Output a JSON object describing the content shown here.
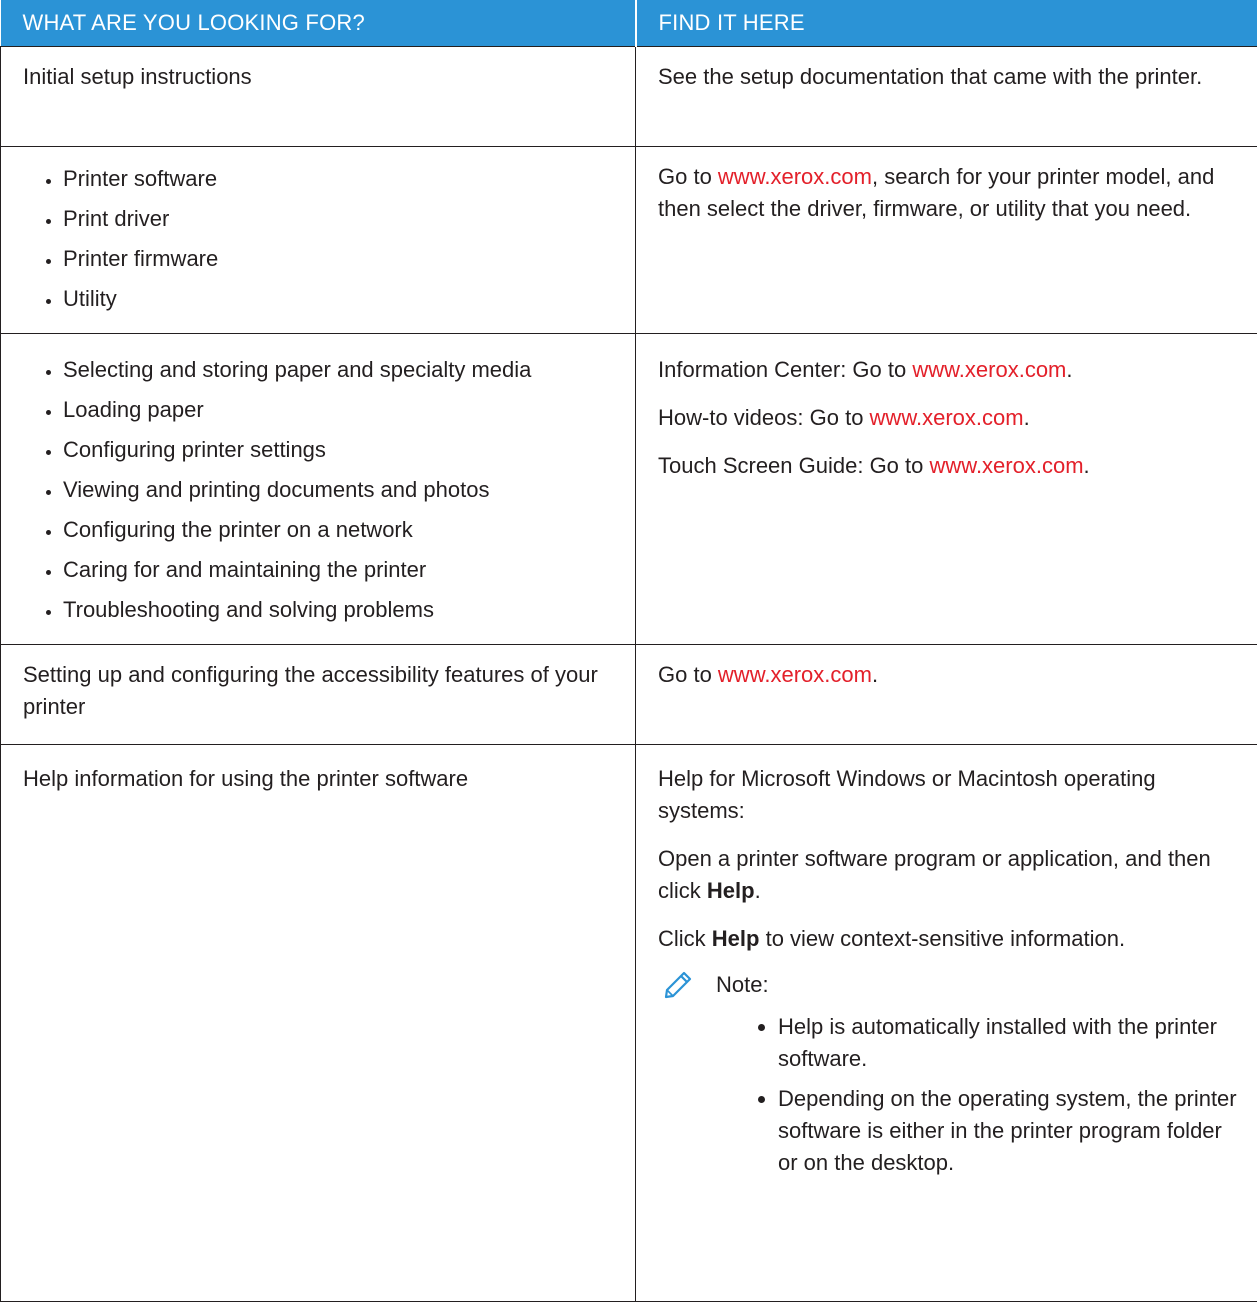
{
  "header": {
    "col1": "WHAT ARE YOU LOOKING FOR?",
    "col2": "FIND IT HERE"
  },
  "rows": [
    {
      "left_text": "Initial setup instructions",
      "right_text": "See the setup documentation that came with the printer."
    },
    {
      "left_items": [
        "Printer software",
        "Print driver",
        "Printer firmware",
        "Utility"
      ],
      "right": {
        "prefix": "Go to ",
        "link": "www.xerox.com",
        "suffix": ", search for your printer model, and then select the driver, firmware, or utility that you need."
      }
    },
    {
      "left_items": [
        "Selecting and storing paper and specialty media",
        "Loading paper",
        "Configuring printer settings",
        "Viewing and printing documents and photos",
        "Configuring the printer on a network",
        "Caring for and maintaining the printer",
        "Troubleshooting and solving problems"
      ],
      "right_lines": [
        {
          "prefix": "Information Center: Go to ",
          "link": "www.xerox.com",
          "suffix": "."
        },
        {
          "prefix": "How-to videos: Go to ",
          "link": "www.xerox.com",
          "suffix": "."
        },
        {
          "prefix": "Touch Screen Guide: Go to ",
          "link": "www.xerox.com",
          "suffix": "."
        }
      ]
    },
    {
      "left_text": "Setting up and configuring the accessibility features of your printer",
      "right": {
        "prefix": "Go to ",
        "link": "www.xerox.com",
        "suffix": "."
      }
    },
    {
      "left_text": "Help information for using the printer software",
      "right_p1": "Help for Microsoft Windows or Macintosh operating systems:",
      "right_p2": {
        "prefix": "Open a printer software program or application, and then click ",
        "bold": "Help",
        "suffix": "."
      },
      "right_p3": {
        "prefix": "Click ",
        "bold": "Help",
        "suffix": " to view context-sensitive information."
      },
      "note_label": "Note:",
      "note_icon": "pencil-icon",
      "notes": [
        "Help is automatically installed with the printer software.",
        "Depending on the operating system, the printer software is either in the printer program folder or on the desktop."
      ]
    }
  ],
  "colors": {
    "header_bg": "#2b93d6",
    "link": "#e3202a",
    "text": "#231f20"
  }
}
